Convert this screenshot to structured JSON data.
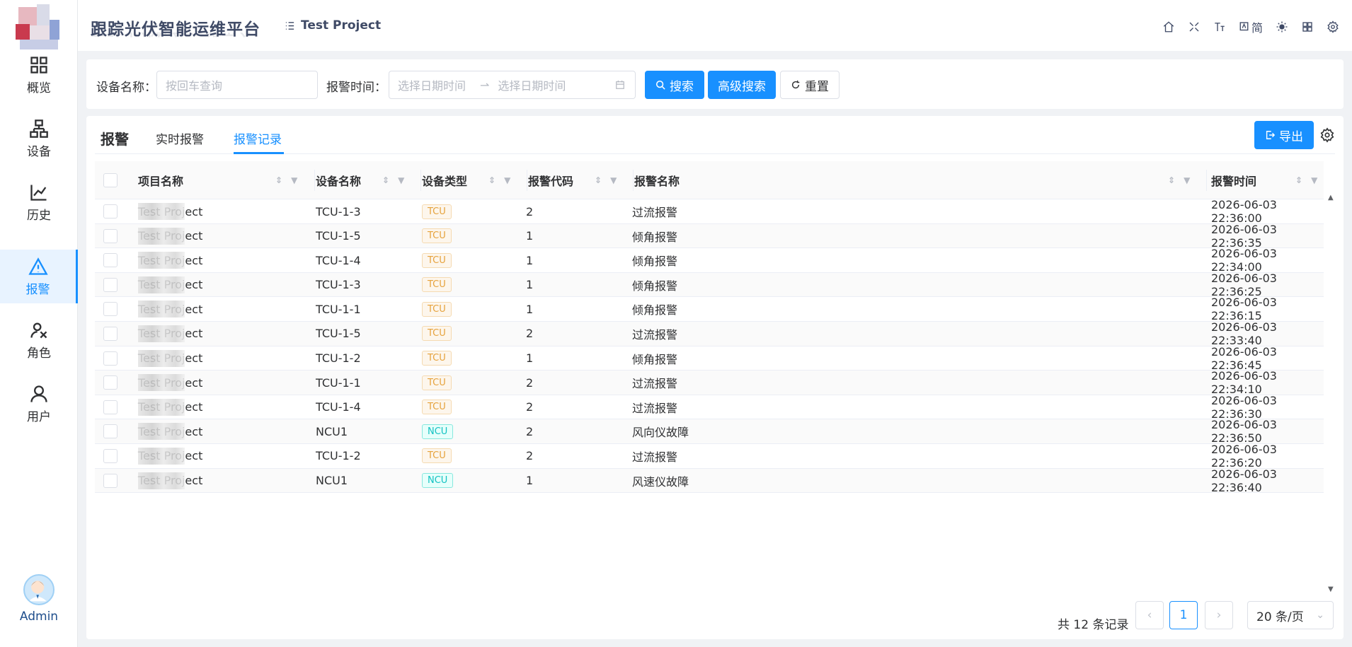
{
  "sidebar": {
    "items": [
      {
        "label": "概览",
        "icon": "dashboard-icon"
      },
      {
        "label": "设备",
        "icon": "device-icon"
      },
      {
        "label": "历史",
        "icon": "chart-line-icon"
      },
      {
        "label": "报警",
        "icon": "warning-icon"
      },
      {
        "label": "角色",
        "icon": "role-icon"
      },
      {
        "label": "用户",
        "icon": "user-icon"
      }
    ],
    "active": "报警",
    "admin": "Admin"
  },
  "header": {
    "title": "跟踪光伏智能运维平台",
    "project": "Test Project",
    "lang_label": "简",
    "icons": [
      "home-icon",
      "fullscreen-icon",
      "font-size-icon",
      "translate-icon",
      "theme-icon",
      "layout-icon",
      "settings-icon"
    ]
  },
  "search": {
    "device_name_label": "设备名称",
    "device_name_placeholder": "按回车查询",
    "alarm_time_label": "报警时间",
    "start_placeholder": "选择日期时间",
    "end_placeholder": "选择日期时间",
    "search_btn": "搜索",
    "advanced_btn": "高级搜索",
    "reset_btn": "重置"
  },
  "card": {
    "title": "报警",
    "tabs": [
      "实时报警",
      "报警记录"
    ],
    "active_tab": "报警记录",
    "export_btn": "导出"
  },
  "table": {
    "columns": [
      "项目名称",
      "设备名称",
      "设备类型",
      "报警代码",
      "报警名称",
      "报警时间"
    ],
    "rows": [
      {
        "project": "Test Project",
        "device": "TCU-1-3",
        "type": "TCU",
        "code": "2",
        "name": "过流报警",
        "time": "2026-06-03 22:36:00"
      },
      {
        "project": "Test Project",
        "device": "TCU-1-5",
        "type": "TCU",
        "code": "1",
        "name": "倾角报警",
        "time": "2026-06-03 22:36:35"
      },
      {
        "project": "Test Project",
        "device": "TCU-1-4",
        "type": "TCU",
        "code": "1",
        "name": "倾角报警",
        "time": "2026-06-03 22:34:00"
      },
      {
        "project": "Test Project",
        "device": "TCU-1-3",
        "type": "TCU",
        "code": "1",
        "name": "倾角报警",
        "time": "2026-06-03 22:36:25"
      },
      {
        "project": "Test Project",
        "device": "TCU-1-1",
        "type": "TCU",
        "code": "1",
        "name": "倾角报警",
        "time": "2026-06-03 22:36:15"
      },
      {
        "project": "Test Project",
        "device": "TCU-1-5",
        "type": "TCU",
        "code": "2",
        "name": "过流报警",
        "time": "2026-06-03 22:33:40"
      },
      {
        "project": "Test Project",
        "device": "TCU-1-2",
        "type": "TCU",
        "code": "1",
        "name": "倾角报警",
        "time": "2026-06-03 22:36:45"
      },
      {
        "project": "Test Project",
        "device": "TCU-1-1",
        "type": "TCU",
        "code": "2",
        "name": "过流报警",
        "time": "2026-06-03 22:34:10"
      },
      {
        "project": "Test Project",
        "device": "TCU-1-4",
        "type": "TCU",
        "code": "2",
        "name": "过流报警",
        "time": "2026-06-03 22:36:30"
      },
      {
        "project": "Test Project",
        "device": "NCU1",
        "type": "NCU",
        "code": "2",
        "name": "风向仪故障",
        "time": "2026-06-03 22:36:50"
      },
      {
        "project": "Test Project",
        "device": "TCU-1-2",
        "type": "TCU",
        "code": "2",
        "name": "过流报警",
        "time": "2026-06-03 22:36:20"
      },
      {
        "project": "Test Project",
        "device": "NCU1",
        "type": "NCU",
        "code": "1",
        "name": "风速仪故障",
        "time": "2026-06-03 22:36:40"
      }
    ]
  },
  "pagination": {
    "total_text": "共 12 条记录",
    "current_page": "1",
    "page_size": "20 条/页"
  },
  "colors": {
    "primary": "#1890ff",
    "tag_tcu": "#e6a23c",
    "tag_ncu": "#13c2c2"
  }
}
